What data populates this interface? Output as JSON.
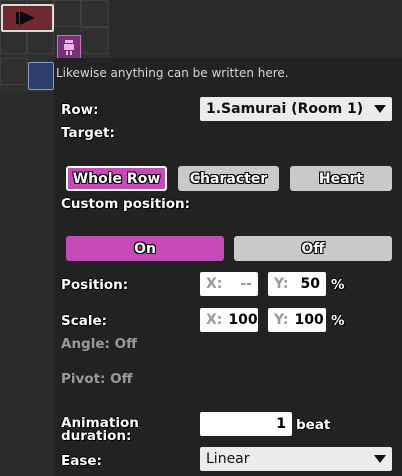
{
  "tooltip": "Likewise anything can be written here.",
  "row": {
    "label": "Row:",
    "value": "1.Samurai (Room 1)"
  },
  "target": {
    "label": "Target:",
    "options": [
      "Whole Row",
      "Character",
      "Heart"
    ],
    "selected": "Whole Row"
  },
  "custom_position": {
    "label": "Custom position:",
    "on_label": "On",
    "off_label": "Off",
    "value": "On"
  },
  "position": {
    "label": "Position:",
    "x_axis": "X:",
    "x_value": "--",
    "y_axis": "Y:",
    "y_value": "50",
    "unit": "%"
  },
  "scale": {
    "label": "Scale:",
    "x_axis": "X:",
    "x_value": "100",
    "y_axis": "Y:",
    "y_value": "100",
    "unit": "%"
  },
  "angle": {
    "label": "Angle: Off"
  },
  "pivot": {
    "label": "Pivot: Off"
  },
  "animation": {
    "label_line1": "Animation",
    "label_line2": "duration:",
    "value": "1",
    "unit": "beat"
  },
  "ease": {
    "label": "Ease:",
    "value": "Linear"
  },
  "colors": {
    "accent": "#c44ab7",
    "panel": "#222222",
    "inactive": "#c9c9c9"
  }
}
